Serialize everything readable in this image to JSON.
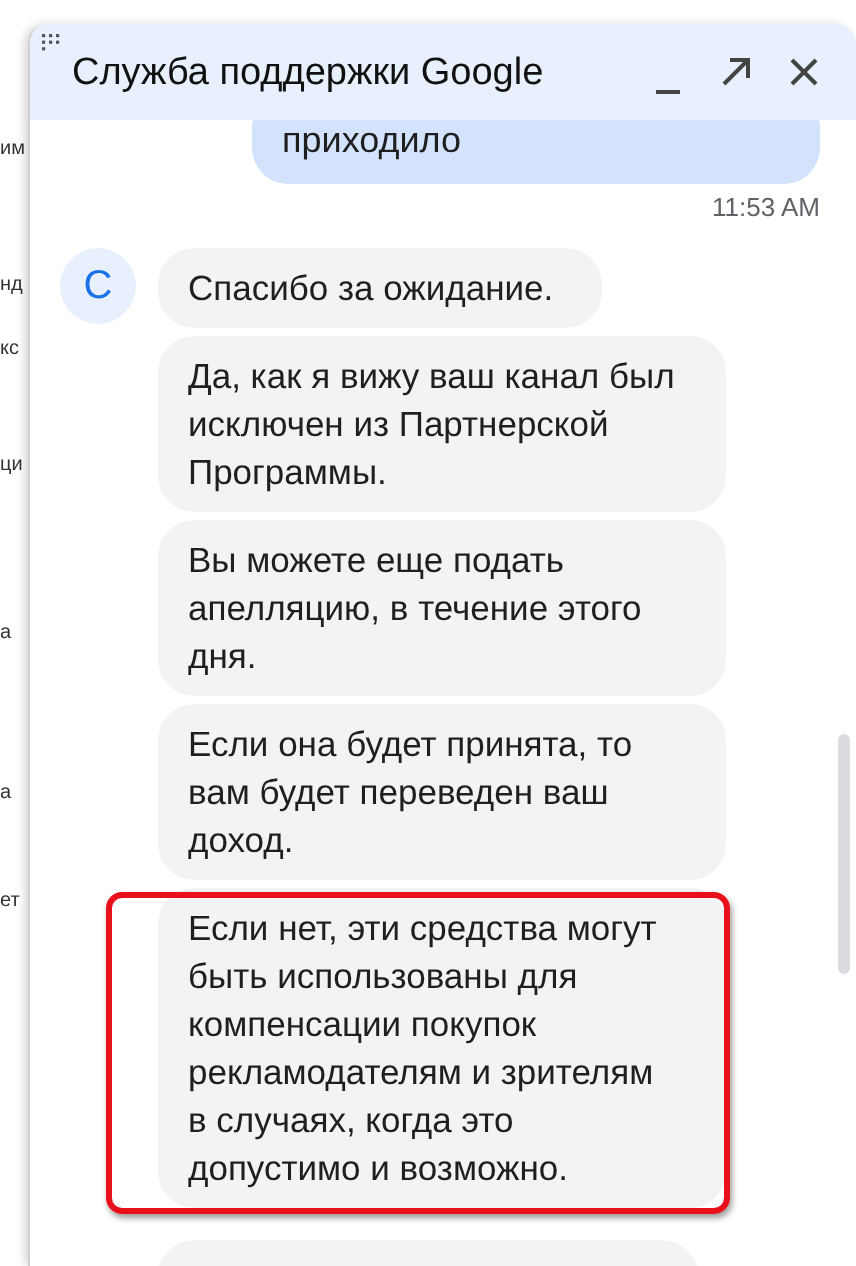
{
  "background_fragments": [
    "им",
    "нд",
    "кс",
    "ци",
    "а",
    "а",
    "ет"
  ],
  "window": {
    "title": "Служба поддержки Google"
  },
  "user_message": {
    "text": "приходило",
    "time": "11:53 AM"
  },
  "agent": {
    "avatar_letter": "С"
  },
  "messages": [
    {
      "text": "Спасибо за ожидание.",
      "highlighted": false
    },
    {
      "text": "Да, как я вижу ваш канал был исключен из Партнерской Программы.",
      "highlighted": false
    },
    {
      "text": "Вы можете еще подать апелляцию, в течение этого дня.",
      "highlighted": false
    },
    {
      "text": "Если она будет принята, то вам будет переведен ваш доход.",
      "highlighted": false
    },
    {
      "text": "Если нет, эти средства могут быть использованы для компенсации покупок рекламодателям и зрителям в случаях, когда это допустимо и возможно.",
      "highlighted": true
    }
  ]
}
